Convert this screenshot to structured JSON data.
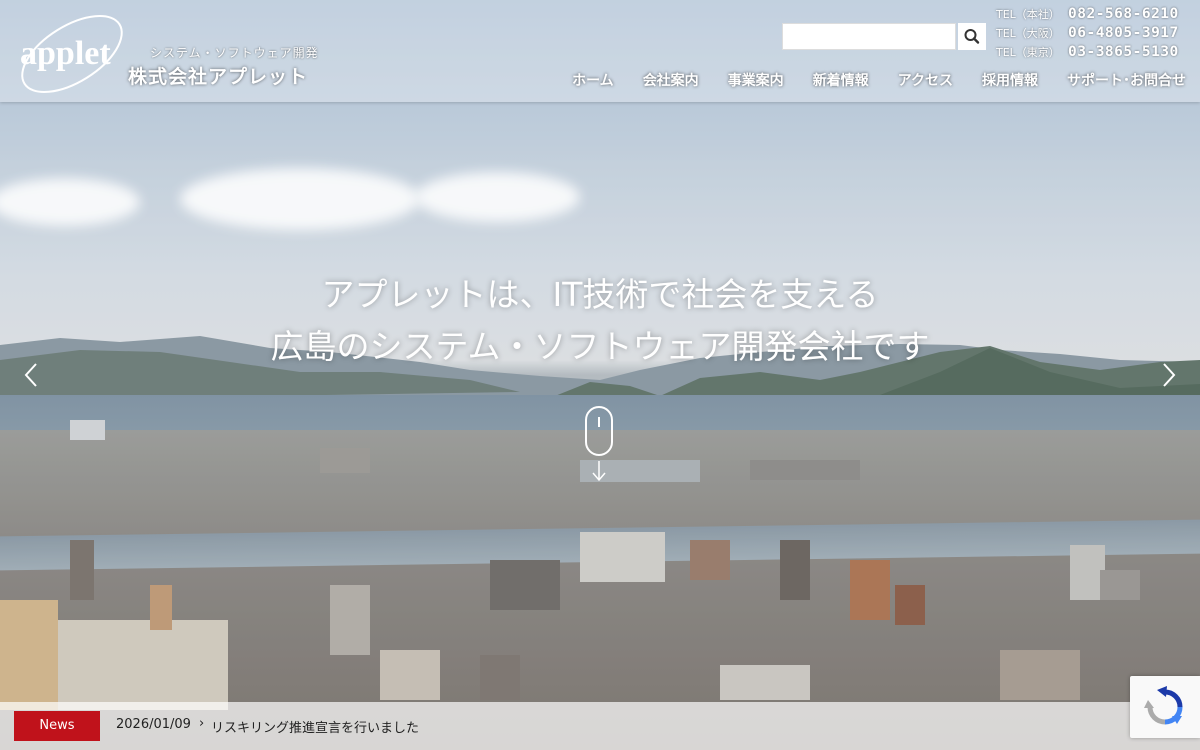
{
  "header": {
    "logo_text": "applet",
    "tagline": "システム・ソフトウェア開発",
    "company": "株式会社アプレット",
    "search": {
      "value": "",
      "placeholder": ""
    },
    "phones": [
      {
        "label": "TEL（本社）",
        "number": "082-568-6210"
      },
      {
        "label": "TEL（大阪）",
        "number": "06-4805-3917"
      },
      {
        "label": "TEL（東京）",
        "number": "03-3865-5130"
      }
    ],
    "nav": [
      {
        "label": "ホーム"
      },
      {
        "label": "会社案内"
      },
      {
        "label": "事業案内"
      },
      {
        "label": "新着情報"
      },
      {
        "label": "アクセス"
      },
      {
        "label": "採用情報"
      },
      {
        "label": "サポート･お問合せ"
      }
    ]
  },
  "hero": {
    "line1": "アプレットは、IT技術で社会を支える",
    "line2": "広島のシステム・ソフトウェア開発会社です"
  },
  "news": {
    "label": "News",
    "date": "2026/01/09",
    "separator": "›",
    "title": "リスキリング推進宣言を行いました"
  },
  "colors": {
    "news_label_bg": "#c0121b",
    "header_text": "#ffffff"
  },
  "icons": {
    "search": "magnifier-icon",
    "prev": "chevron-left-icon",
    "next": "chevron-right-icon",
    "scroll": "mouse-scroll-icon",
    "recaptcha": "recaptcha-icon"
  }
}
